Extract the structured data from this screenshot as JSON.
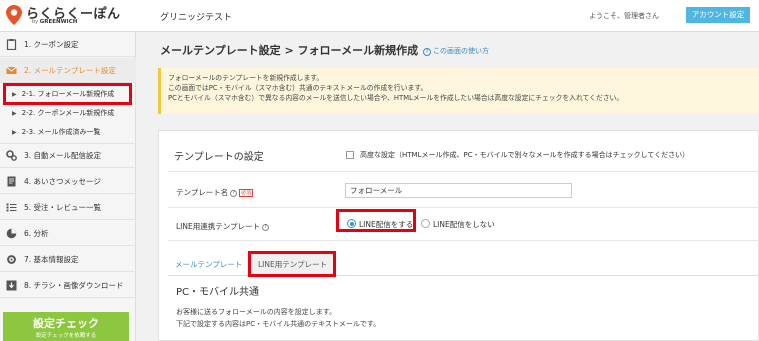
{
  "header": {
    "logo_main": "らくらくーぽん",
    "logo_sub_by": "by",
    "logo_sub_brand": "GREENWICH",
    "site_name": "グリニッジテスト",
    "welcome": "ようこそ、管理者さん",
    "account_button": "アカウント設定"
  },
  "sidebar": {
    "items": [
      {
        "label": "1. クーポン設定",
        "icon": "clipboard-icon"
      },
      {
        "label": "2. メールテンプレート設定",
        "icon": "mail-icon"
      },
      {
        "label": "3. 自動メール配信設定",
        "icon": "gears-icon"
      },
      {
        "label": "4. あいさつメッセージ",
        "icon": "document-icon"
      },
      {
        "label": "5. 受注・レビュー一覧",
        "icon": "list-icon"
      },
      {
        "label": "6. 分析",
        "icon": "pie-chart-icon"
      },
      {
        "label": "7. 基本情報設定",
        "icon": "gear-icon"
      },
      {
        "label": "8. チラシ・画像ダウンロード",
        "icon": "download-icon"
      }
    ],
    "sub_items": [
      {
        "label": "2-1. フォローメール新規作成"
      },
      {
        "label": "2-2. クーポンメール新規作成"
      },
      {
        "label": "2-3. メール作成済み一覧"
      }
    ],
    "promo_title": "設定チェック",
    "promo_sub": "設定チェックを依頼する"
  },
  "main": {
    "page_title": "メールテンプレート設定 > フォローメール新規作成",
    "help_link": "この画面の使い方",
    "info_lines": [
      "フォローメールのテンプレートを新規作成します。",
      "この画面ではPC・モバイル（スマホ含む）共通のテキストメールの作成を行います。",
      "PCとモバイル（スマホ含む）で異なる内容のメールを送信したい場合や、HTMLメールを作成したい場合は高度な設定にチェックを入れてください。"
    ],
    "section_title": "テンプレートの設定",
    "advanced_label": "高度な設定（HTMLメール作成、PC・モバイルで別々なメールを作成する場合はチェックしてください）",
    "template_name_label": "テンプレート名",
    "required_badge": "必須",
    "template_name_value": "フォローメール",
    "line_label": "LINE用連携テンプレート",
    "line_on": "LINE配信をする",
    "line_off": "LINE配信をしない",
    "tab_mail": "メールテンプレート",
    "tab_line": "LINE用テンプレート",
    "pc_title": "PC・モバイル共通",
    "desc_lines": [
      "お客様に送るフォローメールの内容を設定します。",
      "下記で設定する内容はPC・モバイル共通のテキストメールです。"
    ]
  }
}
